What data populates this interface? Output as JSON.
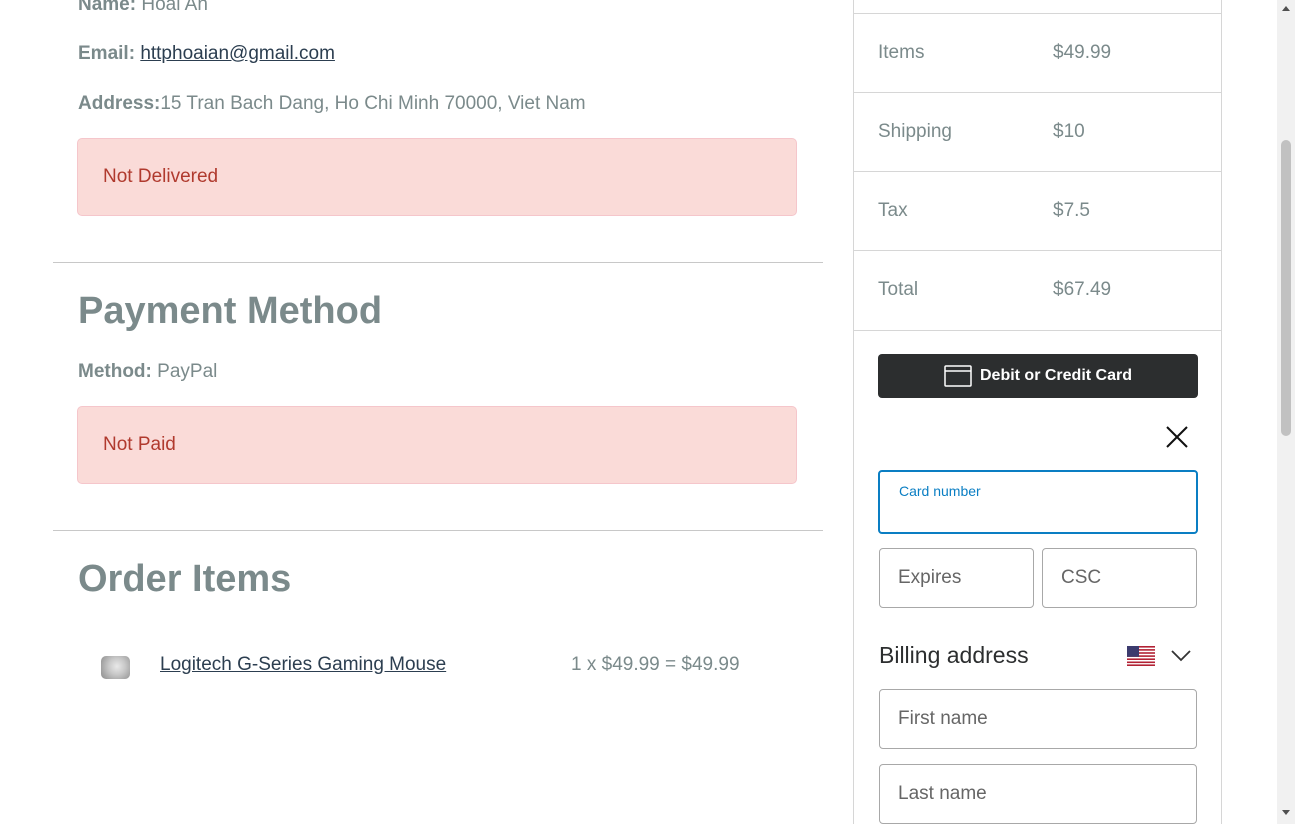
{
  "shipping": {
    "name_label": "Name:",
    "name_value": "Hoai An",
    "email_label": "Email:",
    "email_value": "httphoaian@gmail.com",
    "address_label": "Address:",
    "address_value": "15 Tran Bach Dang, Ho Chi Minh 70000, Viet Nam",
    "status": "Not Delivered"
  },
  "payment": {
    "heading": "Payment Method",
    "method_label": "Method:",
    "method_value": "PayPal",
    "status": "Not Paid"
  },
  "order_items": {
    "heading": "Order Items",
    "items": [
      {
        "name": "Logitech G-Series Gaming Mouse",
        "price_line": "1 x $49.99 = $49.99"
      }
    ]
  },
  "summary": {
    "rows": [
      {
        "label": "Items",
        "value": "$49.99"
      },
      {
        "label": "Shipping",
        "value": "$10"
      },
      {
        "label": "Tax",
        "value": "$7.5"
      },
      {
        "label": "Total",
        "value": "$67.49"
      }
    ]
  },
  "paypal_form": {
    "card_button": "Debit or Credit Card",
    "card_number_label": "Card number",
    "expires_placeholder": "Expires",
    "csc_placeholder": "CSC",
    "billing_heading": "Billing address",
    "first_name_placeholder": "First name",
    "last_name_placeholder": "Last name",
    "country_flag": "us-flag-icon"
  }
}
